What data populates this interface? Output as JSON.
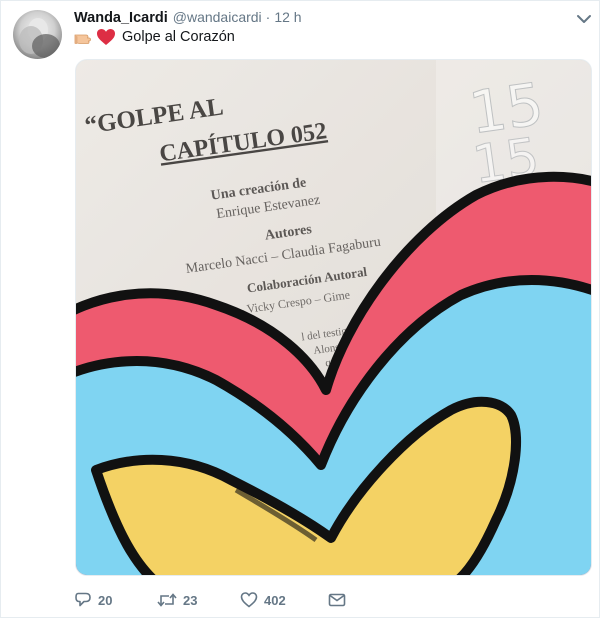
{
  "tweet": {
    "display_name": "Wanda_Icardi",
    "handle": "@wandaicardi",
    "separator": "·",
    "time": "12 h",
    "text": "Golpe al Corazón",
    "emoji_icons": [
      "backhand-index-pointing-right-icon",
      "red-heart-icon"
    ]
  },
  "media": {
    "paper_lines": [
      "“GOLPE AL",
      "CAPÍTULO 052",
      "Una creación de",
      "Enrique Estevanez",
      "Autores",
      "Marcelo Nacci – Claudia Fagaburu",
      "Colaboración Autoral",
      "Natalia Torres – Vicky Crespo – Gime",
      "l del testigo del",
      "Alonso le",
      "que"
    ],
    "overlay_numbers": [
      "15",
      "15"
    ],
    "colors": {
      "paper": "#e9e4de",
      "heart_outer": "#ee5a6f",
      "heart_middle": "#7fd4f2",
      "heart_inner": "#f4d264",
      "outline": "#111111"
    }
  },
  "actions": {
    "reply_count": "20",
    "retweet_count": "23",
    "like_count": "402"
  },
  "colors": {
    "text_primary": "#14171a",
    "text_secondary": "#657786",
    "border": "#e6ecf0"
  }
}
